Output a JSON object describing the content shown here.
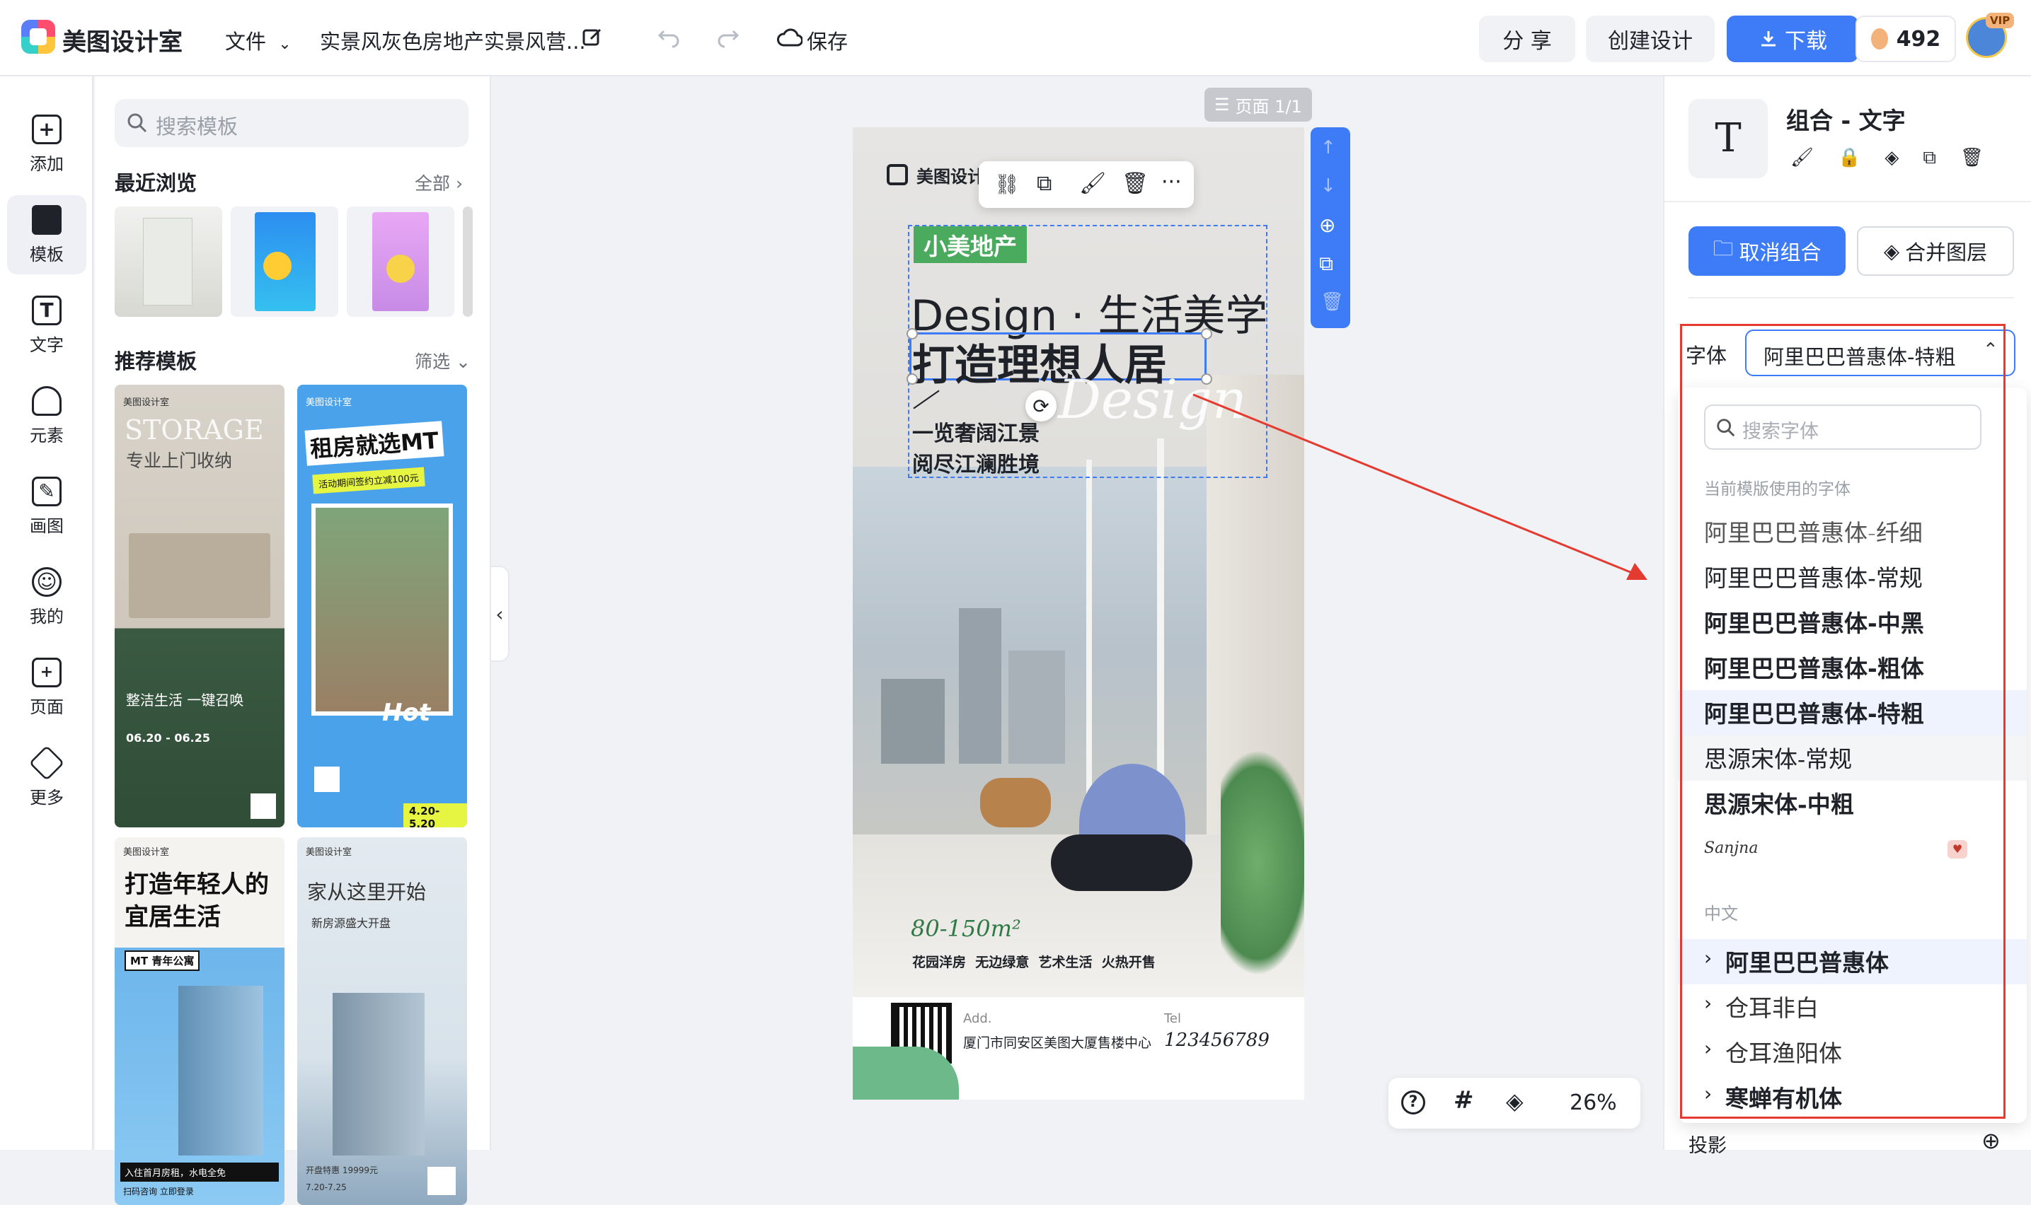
{
  "topbar": {
    "app_name": "美图设计室",
    "file_menu": "文件",
    "doc_title": "实景风灰色房地产实景风营...",
    "save": "保存",
    "share": "分 享",
    "create": "创建设计",
    "download": "下载",
    "coins": "492",
    "vip": "VIP"
  },
  "rail": {
    "items": [
      {
        "label": "添加",
        "icon": "plus-icon"
      },
      {
        "label": "模板",
        "icon": "template-icon"
      },
      {
        "label": "文字",
        "icon": "text-icon"
      },
      {
        "label": "元素",
        "icon": "shapes-icon"
      },
      {
        "label": "画图",
        "icon": "draw-icon"
      },
      {
        "label": "我的",
        "icon": "user-icon"
      },
      {
        "label": "页面",
        "icon": "page-icon"
      },
      {
        "label": "更多",
        "icon": "box-icon"
      }
    ]
  },
  "templates": {
    "search_placeholder": "搜索模板",
    "recent_title": "最近浏览",
    "recent_all": "全部",
    "recommend_title": "推荐模板",
    "recommend_filter": "筛选",
    "cards": [
      {
        "brand": "美图设计室",
        "headline": "STORAGE",
        "sub": "专业上门收纳",
        "tag": "整洁生活 一键召唤",
        "dates": "06.20 - 06.25"
      },
      {
        "brand": "美图设计室",
        "headline": "租房就选MT",
        "sub": "活动期间签约立减100元",
        "tag": "Hot",
        "dates": "4.20-5.20"
      },
      {
        "brand": "美图设计室",
        "headline": "打造年轻人的宜居生活",
        "sub": "MT 青年公寓",
        "tag": "入住首月房租，水电全免",
        "dates": "扫码咨询 立即登录"
      },
      {
        "brand": "美图设计室",
        "headline": "家从这里开始",
        "sub": "新房源盛大开盘",
        "tag": "开盘特惠 19999元",
        "dates": "7.20-7.25"
      }
    ]
  },
  "canvas": {
    "page_indicator": "页面 1/1",
    "brand": "美图设计室",
    "tag": "小美地产",
    "line1": "Design · 生活美学",
    "line2": "打造理想人居",
    "slogan_a": "一览奢阔江景",
    "slogan_b": "阅尽江澜胜境",
    "script_word": "Design",
    "area": "80-150m²",
    "features": "花园洋房  无边绿意  艺术生活  火热开售",
    "addr_label": "Add.",
    "addr": "厦门市同安区美图大厦售楼中心",
    "tel_label": "Tel",
    "tel": "123456789",
    "zoom": "26%"
  },
  "rightpanel": {
    "title": "组合 - 文字",
    "ungroup": "取消组合",
    "merge": "合并图层",
    "font_label": "字体",
    "font_selected": "阿里巴巴普惠体-特粗",
    "font_search_placeholder": "搜索字体",
    "section_current": "当前模版使用的字体",
    "current_fonts": [
      "阿里巴巴普惠体-纤细",
      "阿里巴巴普惠体-常规",
      "阿里巴巴普惠体-中黑",
      "阿里巴巴普惠体-粗体",
      "阿里巴巴普惠体-特粗",
      "思源宋体-常规",
      "思源宋体-中粗"
    ],
    "script_font": "Sanjna",
    "section_cn": "中文",
    "cn_fonts": [
      "阿里巴巴普惠体",
      "仓耳非白",
      "仓耳渔阳体",
      "寒蝉有机体"
    ],
    "shadow": "投影"
  },
  "colors": {
    "accent": "#3d7bf7",
    "annotation": "#e53a2f",
    "tag_green": "#4aaa5d"
  }
}
